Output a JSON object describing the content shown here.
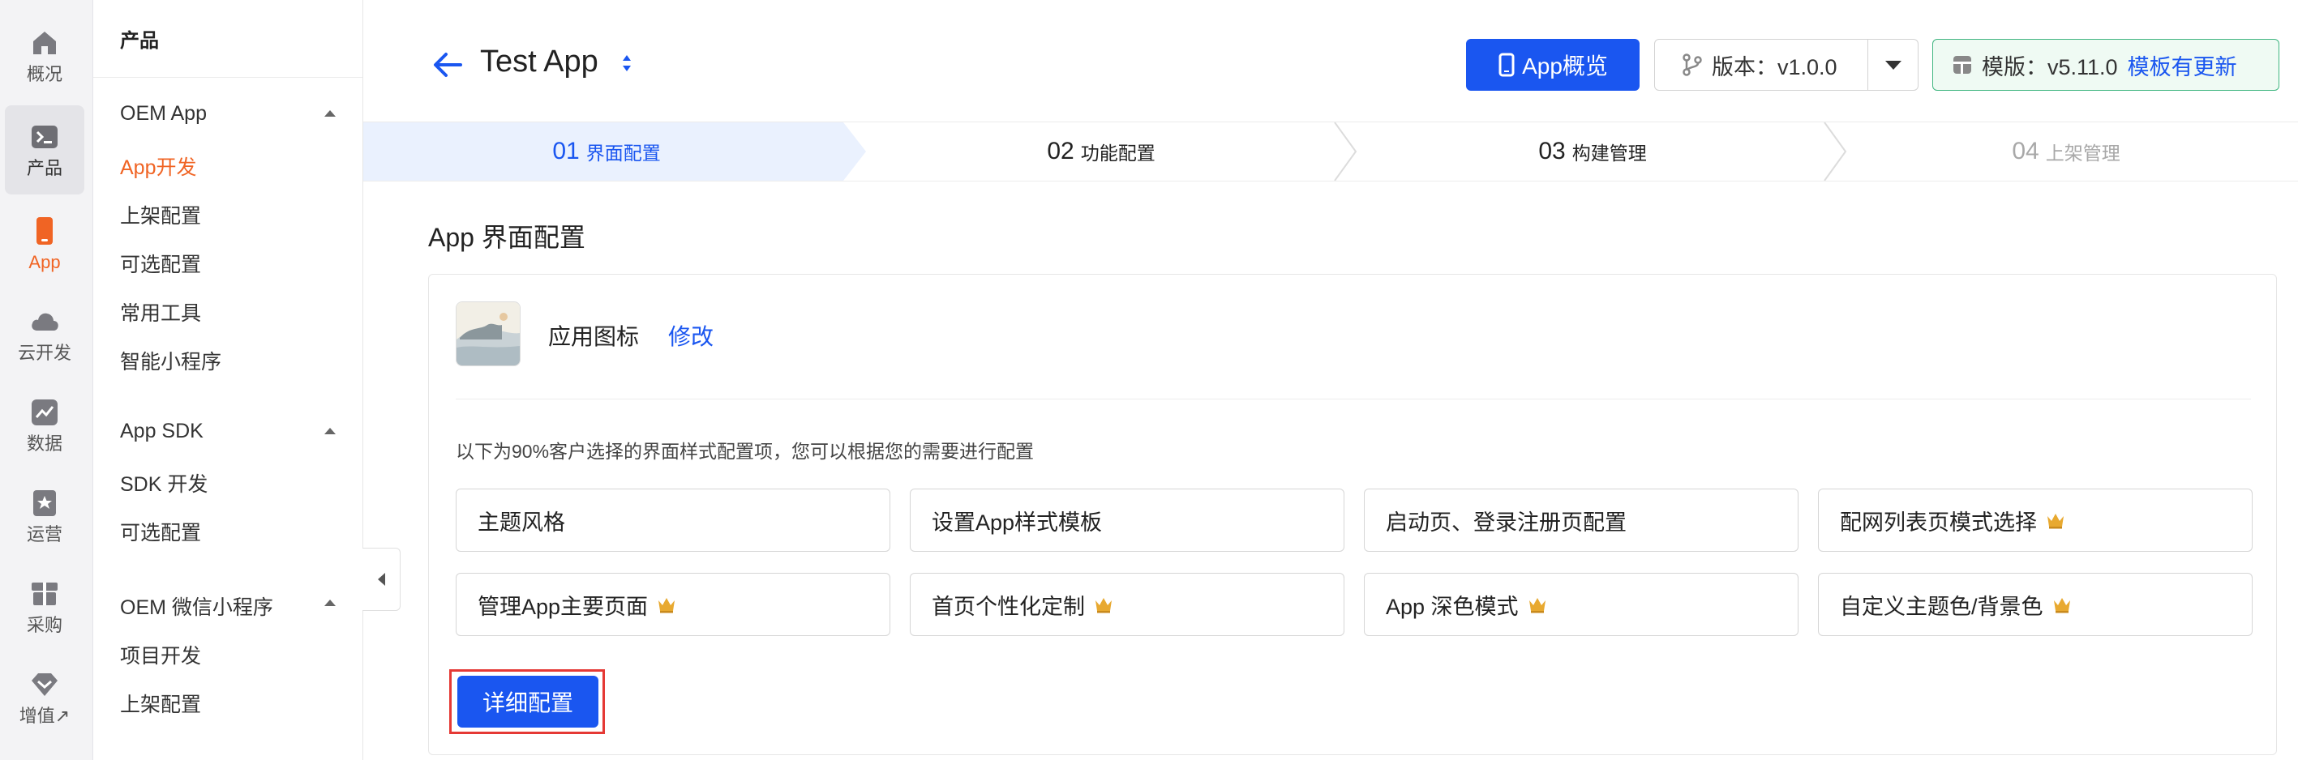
{
  "rail": [
    {
      "label": "概况",
      "icon": "home-icon"
    },
    {
      "label": "产品",
      "icon": "terminal-icon"
    },
    {
      "label": "App",
      "icon": "phone-icon"
    },
    {
      "label": "云开发",
      "icon": "cloud-icon"
    },
    {
      "label": "数据",
      "icon": "chart-icon"
    },
    {
      "label": "运营",
      "icon": "bookmark-icon"
    },
    {
      "label": "采购",
      "icon": "box-icon"
    },
    {
      "label": "增值↗",
      "icon": "diamond-icon"
    }
  ],
  "sidebar": {
    "header": "产品",
    "groups": [
      {
        "title": "OEM App",
        "items": [
          "App开发",
          "上架配置",
          "可选配置",
          "常用工具",
          "智能小程序"
        ]
      },
      {
        "title": "App SDK",
        "items": [
          "SDK 开发",
          "可选配置"
        ]
      },
      {
        "title": "OEM 微信小程序",
        "items": [
          "项目开发",
          "上架配置"
        ]
      }
    ]
  },
  "header": {
    "title": "Test App",
    "overview_label": "App概览",
    "version_label": "版本：v1.0.0",
    "template_label": "模版：v5.11.0",
    "template_update": "模板有更新"
  },
  "steps": [
    {
      "num": "01",
      "label": "界面配置"
    },
    {
      "num": "02",
      "label": "功能配置"
    },
    {
      "num": "03",
      "label": "构建管理"
    },
    {
      "num": "04",
      "label": "上架管理"
    }
  ],
  "main": {
    "section_title": "App 界面配置",
    "app_icon_label": "应用图标",
    "modify_label": "修改",
    "hint": "以下为90%客户选择的界面样式配置项，您可以根据您的需要进行配置",
    "options": [
      {
        "label": "主题风格",
        "premium": false
      },
      {
        "label": "设置App样式模板",
        "premium": false
      },
      {
        "label": "启动页、登录注册页配置",
        "premium": false
      },
      {
        "label": "配网列表页模式选择",
        "premium": true
      },
      {
        "label": "管理App主要页面",
        "premium": true
      },
      {
        "label": "首页个性化定制",
        "premium": true
      },
      {
        "label": "App 深色模式",
        "premium": true
      },
      {
        "label": "自定义主题色/背景色",
        "premium": true
      }
    ],
    "detail_button": "详细配置"
  },
  "colors": {
    "accent": "#1a56f0",
    "active_nav": "#f06424",
    "highlight": "#e53935",
    "crown": "#e8a930"
  }
}
